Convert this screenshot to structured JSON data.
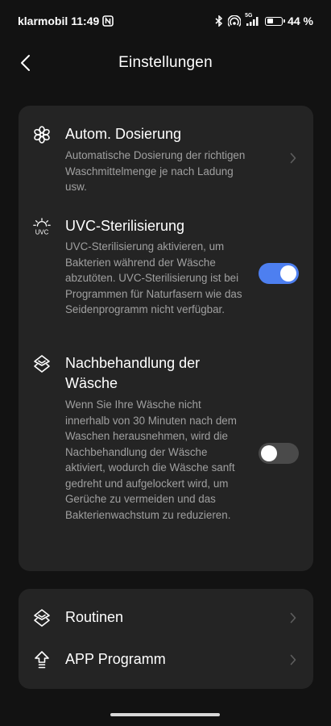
{
  "status_bar": {
    "carrier": "klarmobil",
    "time": "11:49",
    "network": "5G",
    "battery": "44 %",
    "battery_level": 0.44,
    "icons": [
      "nfc-icon",
      "bluetooth-icon",
      "hotspot-icon",
      "signal-icon",
      "battery-icon"
    ]
  },
  "header": {
    "title": "Einstellungen",
    "back_icon": "chevron-left-icon"
  },
  "settings": [
    {
      "icon": "flower-icon",
      "title": "Autom. Dosierung",
      "description": "Automatische Dosierung der richtigen Waschmittelmenge je nach Ladung usw.",
      "control": "chevron"
    },
    {
      "icon": "uvc-icon",
      "icon_text": "UVC",
      "title": "UVC-Sterilisierung",
      "description": "UVC-Sterilisierung aktivieren, um Bakterien während der Wäsche abzutöten. UVC-Sterilisierung ist bei Programmen für Naturfasern wie das Seidenprogramm nicht verfügbar.",
      "control": "toggle",
      "enabled": true
    },
    {
      "icon": "care-icon",
      "title": "Nachbehandlung der Wäsche",
      "description": "Wenn Sie Ihre Wäsche nicht innerhalb von 30 Minuten nach dem Waschen herausnehmen, wird die Nachbehandlung der Wäsche aktiviert, wodurch die Wäsche sanft gedreht und aufgelockert wird, um Gerüche zu vermeiden und das Bakterienwachstum zu reduzieren.",
      "control": "toggle",
      "enabled": false
    }
  ],
  "menu": [
    {
      "icon": "routines-icon",
      "label": "Routinen"
    },
    {
      "icon": "app-program-icon",
      "label": "APP Programm"
    }
  ],
  "colors": {
    "background": "#121212",
    "card": "#242424",
    "accent": "#4d7ff0",
    "secondary_text": "#a0a0a0"
  }
}
